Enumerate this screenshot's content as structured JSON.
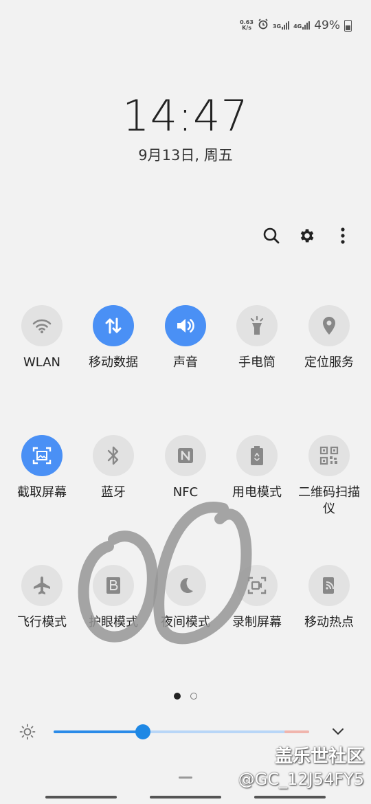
{
  "status": {
    "net_speed_value": "0.63",
    "net_speed_unit": "K/s",
    "sim1": "3G",
    "sim2": "4G",
    "battery": "49%"
  },
  "clock": {
    "time": "14:47",
    "date": "9月13日, 周五"
  },
  "toolbar": {
    "icons": [
      "search-icon",
      "gear-icon",
      "more-vert-icon"
    ]
  },
  "tiles": [
    {
      "label": "WLAN",
      "icon": "wifi-icon",
      "on": false
    },
    {
      "label": "移动数据",
      "icon": "mobile-data-icon",
      "on": true
    },
    {
      "label": "声音",
      "icon": "volume-icon",
      "on": true
    },
    {
      "label": "手电筒",
      "icon": "flashlight-icon",
      "on": false
    },
    {
      "label": "定位服务",
      "icon": "location-icon",
      "on": false
    },
    {
      "label": "截取屏幕",
      "icon": "screenshot-icon",
      "on": true
    },
    {
      "label": "蓝牙",
      "icon": "bluetooth-icon",
      "on": false
    },
    {
      "label": "NFC",
      "icon": "nfc-icon",
      "on": false
    },
    {
      "label": "用电模式",
      "icon": "power-mode-icon",
      "on": false
    },
    {
      "label": "二维码扫描仪",
      "icon": "qr-code-icon",
      "on": false
    },
    {
      "label": "飞行模式",
      "icon": "airplane-icon",
      "on": false
    },
    {
      "label": "护眼模式",
      "icon": "eye-comfort-icon",
      "on": false
    },
    {
      "label": "夜间模式",
      "icon": "night-mode-icon",
      "on": false
    },
    {
      "label": "录制屏幕",
      "icon": "screen-record-icon",
      "on": false
    },
    {
      "label": "移动热点",
      "icon": "hotspot-icon",
      "on": false
    }
  ],
  "pagination": {
    "current": 1,
    "total": 2
  },
  "brightness": {
    "level": 0.35
  },
  "watermark": {
    "site": "盖乐世社区",
    "user": "@GC_12J54FY5"
  },
  "colors": {
    "accent": "#4a90f5",
    "tile_off": "#e2e2e2",
    "background": "#f2f2f2"
  }
}
